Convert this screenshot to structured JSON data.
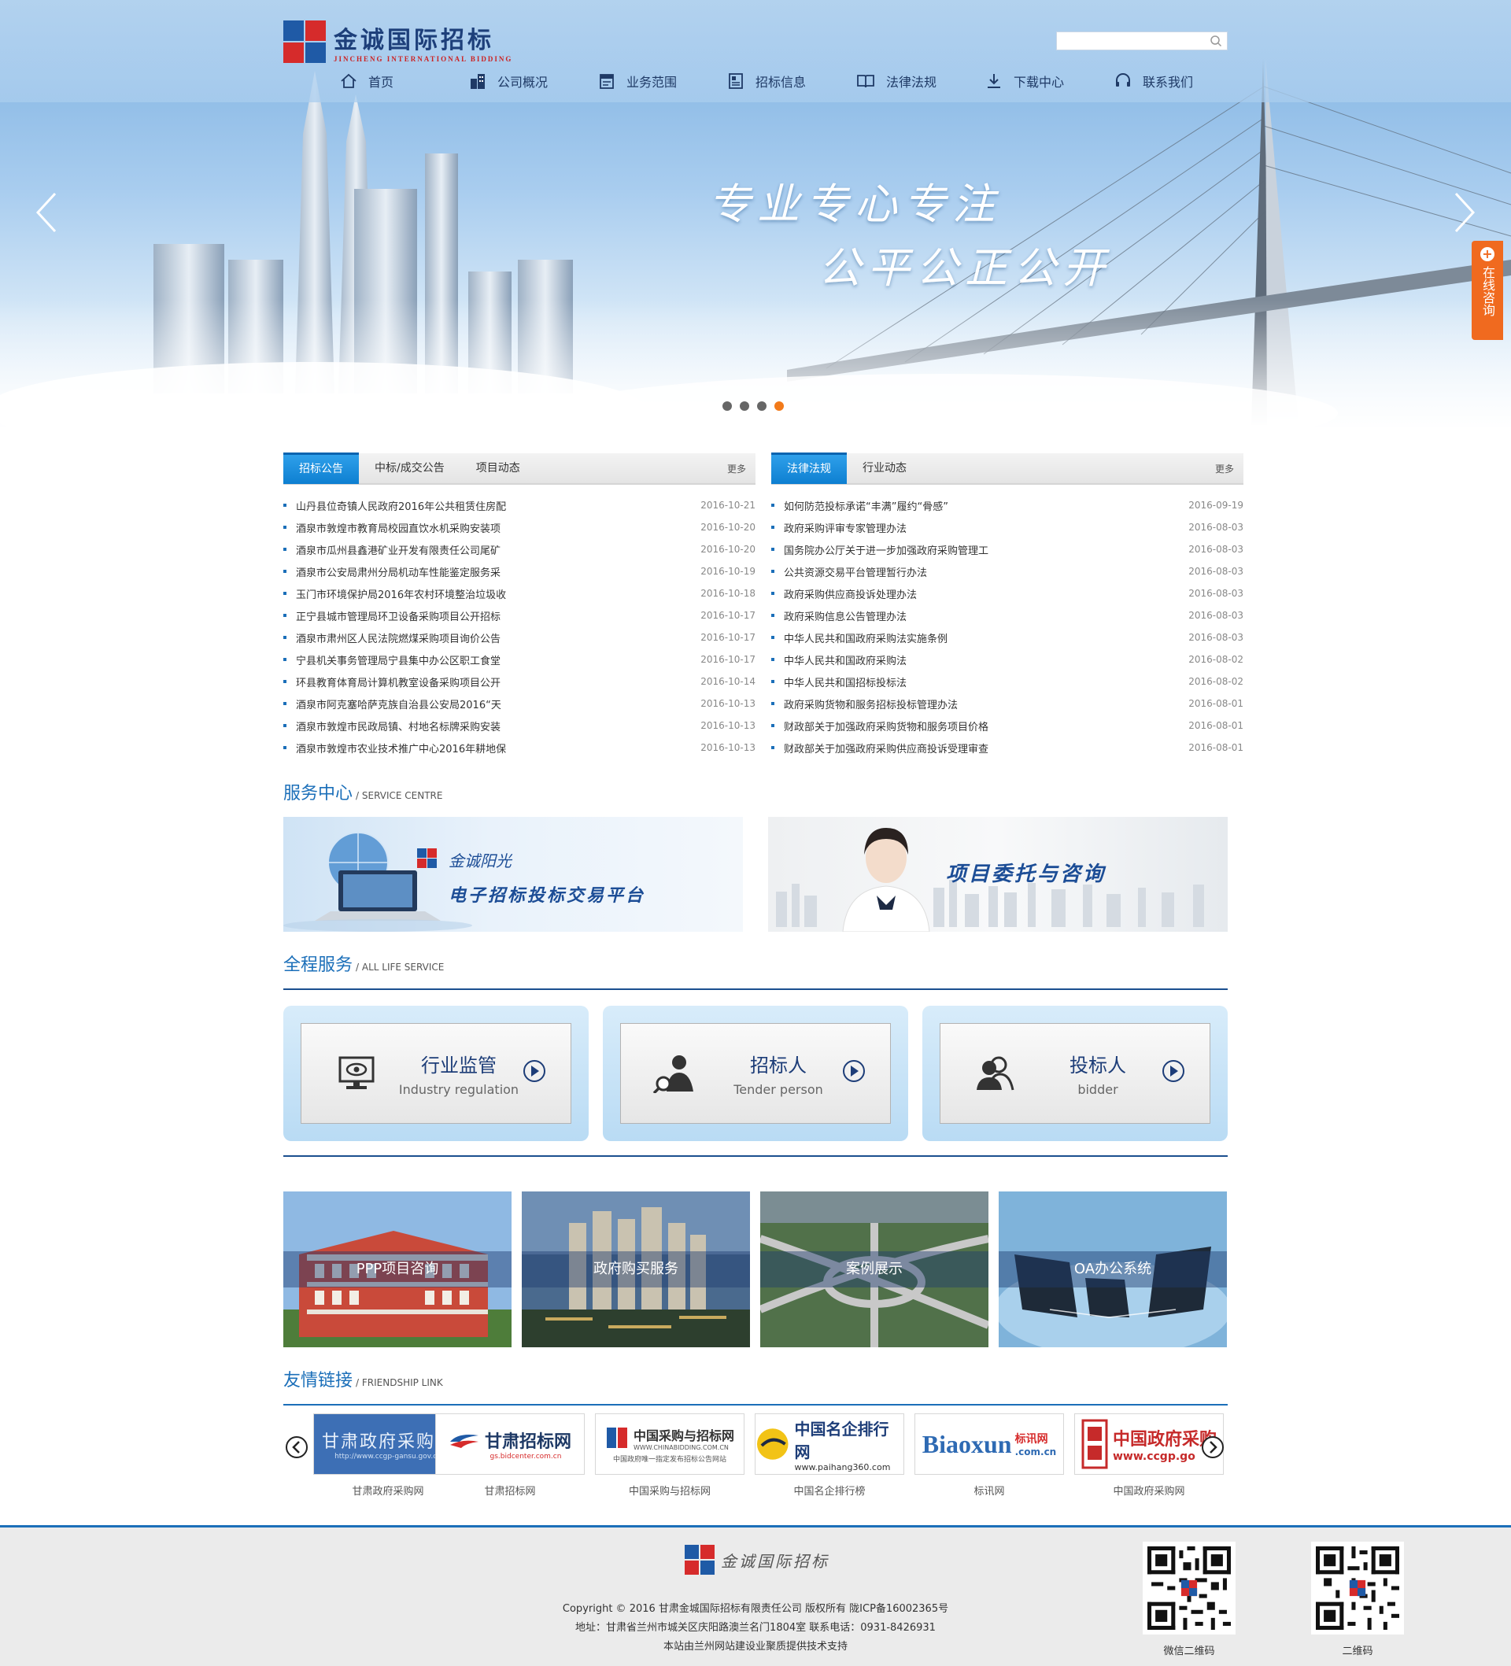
{
  "header": {
    "logo_cn": "金诚国际招标",
    "logo_en": "JINCHENG INTERNATIONAL BIDDING",
    "search_placeholder": "",
    "menu": [
      {
        "label": "首页",
        "icon": "home-icon"
      },
      {
        "label": "公司概况",
        "icon": "building-icon"
      },
      {
        "label": "业务范围",
        "icon": "document-icon"
      },
      {
        "label": "招标信息",
        "icon": "info-board-icon"
      },
      {
        "label": "法律法规",
        "icon": "book-icon"
      },
      {
        "label": "下载中心",
        "icon": "download-icon"
      },
      {
        "label": "联系我们",
        "icon": "headset-icon"
      }
    ]
  },
  "hero": {
    "slogan_line1": "专业专心专注",
    "slogan_line2": "公平公正公开",
    "slide_count": 4,
    "active_slide": 4
  },
  "consult": {
    "label": "在线咨询"
  },
  "news_left": {
    "tabs": [
      "招标公告",
      "中标/成交公告",
      "项目动态"
    ],
    "more": "更多",
    "items": [
      {
        "title": "山丹县位奇镇人民政府2016年公共租赁住房配",
        "date": "2016-10-21"
      },
      {
        "title": "酒泉市敦煌市教育局校园直饮水机采购安装项",
        "date": "2016-10-20"
      },
      {
        "title": "酒泉市瓜州县鑫港矿业开发有限责任公司尾矿",
        "date": "2016-10-20"
      },
      {
        "title": "酒泉市公安局肃州分局机动车性能鉴定服务采",
        "date": "2016-10-19"
      },
      {
        "title": "玉门市环境保护局2016年农村环境整治垃圾收",
        "date": "2016-10-18"
      },
      {
        "title": "正宁县城市管理局环卫设备采购项目公开招标",
        "date": "2016-10-17"
      },
      {
        "title": "酒泉市肃州区人民法院燃煤采购项目询价公告",
        "date": "2016-10-17"
      },
      {
        "title": "宁县机关事务管理局宁县集中办公区职工食堂",
        "date": "2016-10-17"
      },
      {
        "title": "环县教育体育局计算机教室设备采购项目公开",
        "date": "2016-10-14"
      },
      {
        "title": "酒泉市阿克塞哈萨克族自治县公安局2016“天",
        "date": "2016-10-13"
      },
      {
        "title": "酒泉市敦煌市民政局镇、村地名标牌采购安装",
        "date": "2016-10-13"
      },
      {
        "title": "酒泉市敦煌市农业技术推广中心2016年耕地保",
        "date": "2016-10-13"
      }
    ]
  },
  "news_right": {
    "tabs": [
      "法律法规",
      "行业动态"
    ],
    "more": "更多",
    "items": [
      {
        "title": "如何防范投标承诺“丰满”履约“骨感”",
        "date": "2016-09-19"
      },
      {
        "title": "政府采购评审专家管理办法",
        "date": "2016-08-03"
      },
      {
        "title": "国务院办公厅关于进一步加强政府采购管理工",
        "date": "2016-08-03"
      },
      {
        "title": "公共资源交易平台管理暂行办法",
        "date": "2016-08-03"
      },
      {
        "title": "政府采购供应商投诉处理办法",
        "date": "2016-08-03"
      },
      {
        "title": "政府采购信息公告管理办法",
        "date": "2016-08-03"
      },
      {
        "title": "中华人民共和国政府采购法实施条例",
        "date": "2016-08-03"
      },
      {
        "title": "中华人民共和国政府采购法",
        "date": "2016-08-02"
      },
      {
        "title": "中华人民共和国招标投标法",
        "date": "2016-08-02"
      },
      {
        "title": "政府采购货物和服务招标投标管理办法",
        "date": "2016-08-01"
      },
      {
        "title": "财政部关于加强政府采购货物和服务项目价格",
        "date": "2016-08-01"
      },
      {
        "title": "财政部关于加强政府采购供应商投诉受理审查",
        "date": "2016-08-01"
      }
    ]
  },
  "service_centre": {
    "title": "服务中心",
    "subtitle": "/ SERVICE CENTRE",
    "banner_left_brand": "金诚阳光",
    "banner_left_text": "电子招标投标交易平台",
    "banner_right_text": "项目委托与咨询"
  },
  "life_service": {
    "title": "全程服务",
    "subtitle": "/ ALL LIFE SERVICE",
    "cards": [
      {
        "cn": "行业监管",
        "en": "Industry regulation",
        "icon": "monitor-eye-icon"
      },
      {
        "cn": "招标人",
        "en": "Tender person",
        "icon": "person-search-icon"
      },
      {
        "cn": "投标人",
        "en": "bidder",
        "icon": "people-icon"
      }
    ]
  },
  "tiles": [
    {
      "label": "PPP项目咨询"
    },
    {
      "label": "政府购买服务"
    },
    {
      "label": "案例展示"
    },
    {
      "label": "OA办公系统"
    }
  ],
  "friend_links": {
    "title": "友情链接",
    "subtitle": "/ FRIENDSHIP LINK",
    "items": [
      {
        "label": "甘肃政府采购网",
        "logo_text": "甘肃政府采购网",
        "logo_url": "http://www.ccgp-gansu.gov.cn"
      },
      {
        "label": "甘肃招标网",
        "logo_text": "甘肃招标网",
        "logo_url": "gs.bidcenter.com.cn"
      },
      {
        "label": "中国采购与招标网",
        "logo_text": "中国采购与招标网",
        "logo_url": "WWW.CHINABIDDING.COM.CN",
        "logo_slogan": "中国政府唯一指定发布招标公告网站"
      },
      {
        "label": "中国名企排行榜",
        "logo_text": "中国名企排行网",
        "logo_url": "www.paihang360.com"
      },
      {
        "label": "标讯网",
        "logo_text": "Biaoxun",
        "logo_text2": "标讯网",
        "logo_url": ".com.cn"
      },
      {
        "label": "中国政府采购网",
        "logo_text": "中国政府采购",
        "logo_url": "www.ccgp.go"
      }
    ]
  },
  "footer": {
    "logo_text": "金诚国际招标",
    "copyright": "Copyright © 2016 甘肃金城国际招标有限责任公司 版权所有   陇ICP备16002365号",
    "address": "地址：甘肃省兰州市城关区庆阳路澳兰名门1804室   联系电话：0931-8426931",
    "support": "本站由兰州网站建设业聚质提供技术支持",
    "qr_wechat_label": "微信二维码",
    "qr_label": "二维码"
  },
  "colors": {
    "brand_blue": "#1b6fb9",
    "tab_active": "#0d7fd1",
    "logo_red": "#d62b2b",
    "consult_orange": "#f06a1f",
    "dot_active": "#f27a1a"
  }
}
